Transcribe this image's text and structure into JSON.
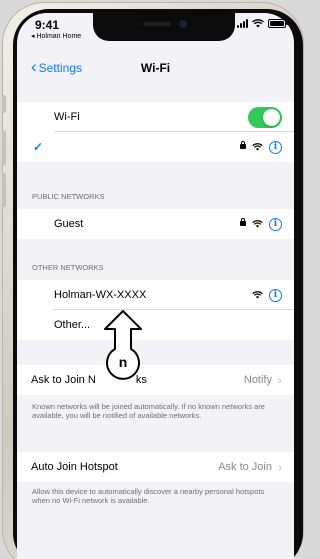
{
  "status": {
    "time": "9:41",
    "back_app": "◂ Holman Home"
  },
  "nav": {
    "back": "Settings",
    "title": "Wi-Fi"
  },
  "wifi": {
    "label": "Wi-Fi",
    "on": true
  },
  "public_networks": {
    "header": "PUBLIC NETWORKS",
    "items": [
      {
        "name": "Guest"
      }
    ]
  },
  "other_networks": {
    "header": "OTHER NETWORKS",
    "items": [
      {
        "name": "Holman-WX-XXXX"
      },
      {
        "name": "Other..."
      }
    ]
  },
  "ask_to_join": {
    "label": "Ask to Join Networks",
    "label_visible": "Ask to Join N",
    "label_tail": "ks",
    "value": "Notify",
    "footnote": "Known networks will be joined automatically. If no known networks are available, you will be notified of available networks."
  },
  "auto_join": {
    "label": "Auto Join Hotspot",
    "value": "Ask to Join",
    "footnote": "Allow this device to automatically discover a nearby personal hotspots when no Wi-Fi network is available."
  },
  "callout": {
    "letter": "n"
  },
  "colors": {
    "accent": "#0a7aff",
    "toggle_on": "#34c759",
    "background": "#f2f2f7"
  }
}
